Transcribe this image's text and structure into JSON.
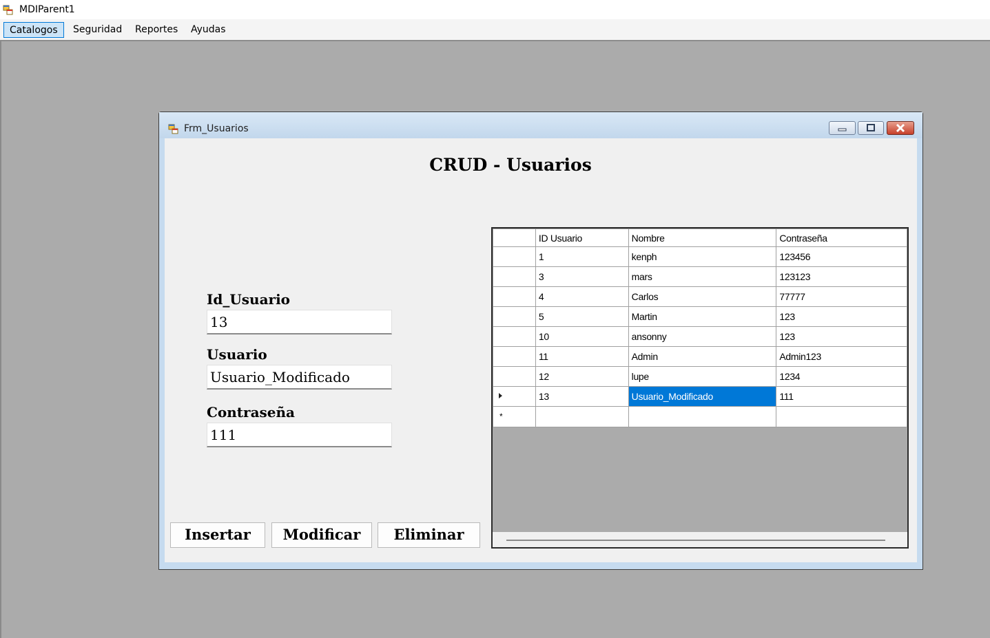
{
  "mdi": {
    "title": "MDIParent1",
    "menu": [
      "Catalogos",
      "Seguridad",
      "Reportes",
      "Ayudas"
    ],
    "active_menu": "Catalogos"
  },
  "child": {
    "title": "Frm_Usuarios",
    "form_title": "CRUD - Usuarios",
    "fields": {
      "id_label": "Id_Usuario",
      "id_value": "13",
      "user_label": "Usuario",
      "user_value": "Usuario_Modificado",
      "pass_label": "Contraseña",
      "pass_value": "111"
    },
    "buttons": {
      "insert": "Insertar",
      "modify": "Modificar",
      "delete": "Eliminar"
    },
    "grid": {
      "columns": [
        "ID Usuario",
        "Nombre",
        "Contraseña"
      ],
      "rows": [
        [
          "1",
          "kenph",
          "123456"
        ],
        [
          "3",
          "mars",
          "123123"
        ],
        [
          "4",
          "Carlos",
          "77777"
        ],
        [
          "5",
          "Martin",
          "123"
        ],
        [
          "10",
          "ansonny",
          "123"
        ],
        [
          "11",
          "Admin",
          "Admin123"
        ],
        [
          "12",
          "lupe",
          "1234"
        ],
        [
          "13",
          "Usuario_Modificado",
          "111"
        ]
      ],
      "current_row_marker": "▸",
      "new_row_marker": "*"
    }
  },
  "colors": {
    "mdi_background": "#ababab",
    "selection": "#0078d7",
    "menu_active": "#cce4f7"
  }
}
